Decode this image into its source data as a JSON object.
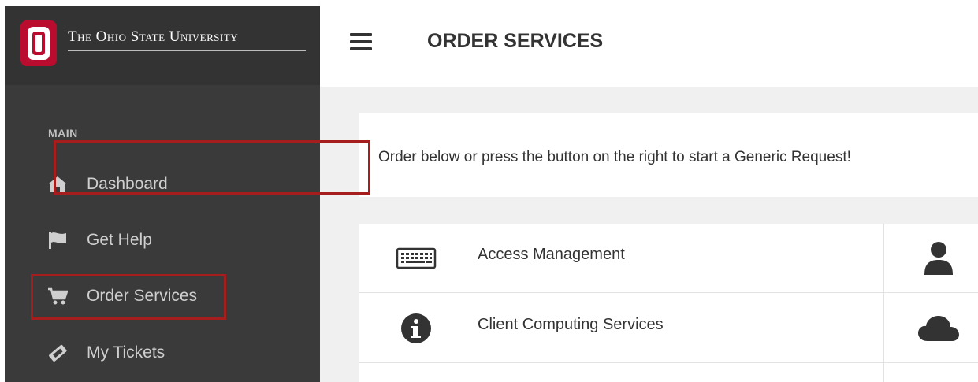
{
  "brand": {
    "name": "The Ohio State University",
    "accent_color": "#ba0c2f"
  },
  "sidebar": {
    "section_label": "MAIN",
    "items": [
      {
        "label": "Dashboard",
        "icon": "home-icon"
      },
      {
        "label": "Get Help",
        "icon": "flag-icon"
      },
      {
        "label": "Order Services",
        "icon": "cart-icon",
        "highlighted": true
      },
      {
        "label": "My Tickets",
        "icon": "ticket-icon"
      }
    ]
  },
  "header": {
    "title": "ORDER SERVICES",
    "menu_icon": "hamburger-icon"
  },
  "main": {
    "notice": "Order below or press the button on the right to start a Generic Request!",
    "services": [
      {
        "label": "Access Management",
        "icon": "keyboard-icon",
        "side_icon": "user-icon",
        "highlighted": true
      },
      {
        "label": "Client Computing Services",
        "icon": "info-icon",
        "side_icon": "cloud-icon"
      }
    ]
  },
  "colors": {
    "sidebar_bg": "#3a3a3a",
    "highlight_border": "#a51d1d"
  }
}
